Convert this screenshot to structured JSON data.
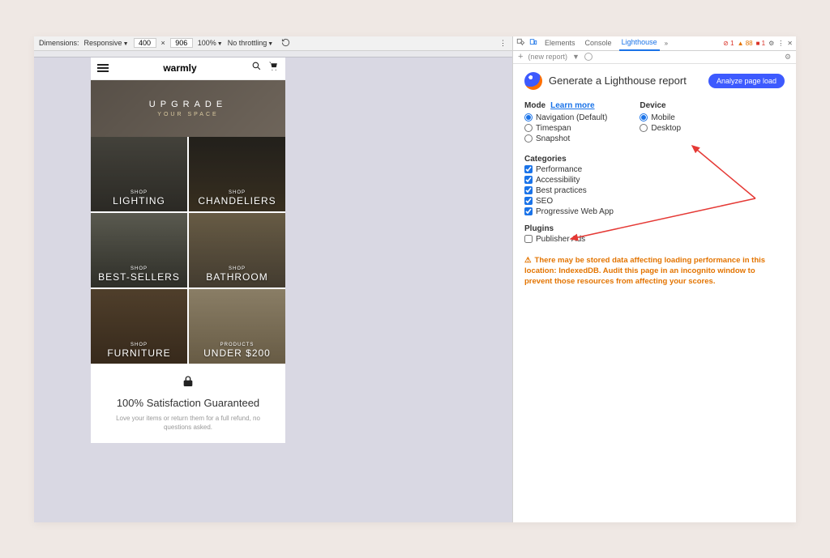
{
  "devtools_top": {
    "dimensions_label": "Dimensions:",
    "dimensions_value": "Responsive",
    "width": "400",
    "height": "906",
    "zoom": "100%",
    "throttling": "No throttling"
  },
  "site": {
    "brand": "warmly",
    "hero_line1": "UPGRADE",
    "hero_line2": "YOUR SPACE",
    "tiles": [
      {
        "shop": "SHOP",
        "cat": "LIGHTING"
      },
      {
        "shop": "SHOP",
        "cat": "CHANDELIERS"
      },
      {
        "shop": "SHOP",
        "cat": "BEST-SELLERS"
      },
      {
        "shop": "SHOP",
        "cat": "BATHROOM"
      },
      {
        "shop": "SHOP",
        "cat": "FURNITURE"
      },
      {
        "shop": "PRODUCTS",
        "cat": "UNDER $200"
      }
    ],
    "sat_title": "100% Satisfaction Guaranteed",
    "sat_sub": "Love your items or return them for a full refund, no questions asked."
  },
  "devtools_tabs": {
    "elements": "Elements",
    "console": "Console",
    "lighthouse": "Lighthouse",
    "status_err": "1",
    "status_warn": "88",
    "status_info": "1"
  },
  "devtools_sub": {
    "new_report": "(new report)"
  },
  "lighthouse": {
    "title": "Generate a Lighthouse report",
    "analyze": "Analyze page load",
    "mode_label": "Mode",
    "learn_more": "Learn more",
    "modes": {
      "nav": "Navigation (Default)",
      "timespan": "Timespan",
      "snapshot": "Snapshot"
    },
    "device_label": "Device",
    "devices": {
      "mobile": "Mobile",
      "desktop": "Desktop"
    },
    "categories_label": "Categories",
    "categories": {
      "perf": "Performance",
      "a11y": "Accessibility",
      "bp": "Best practices",
      "seo": "SEO",
      "pwa": "Progressive Web App"
    },
    "plugins_label": "Plugins",
    "plugins": {
      "ads": "Publisher Ads"
    },
    "warning": "There may be stored data affecting loading performance in this location: IndexedDB. Audit this page in an incognito window to prevent those resources from affecting your scores."
  }
}
